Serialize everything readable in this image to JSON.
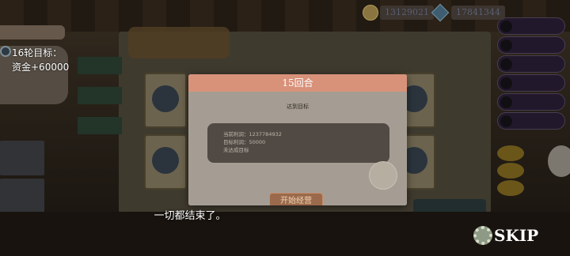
{
  "currency": {
    "gold": "13129021",
    "gems": "17841344"
  },
  "goal": {
    "label": "16轮目标：",
    "value": "资金+60000"
  },
  "modal": {
    "header": "15回合",
    "subtitle": "达到目标",
    "summary": [
      "当前利润：1237784932",
      "目标利润：50000",
      "未达成目标"
    ],
    "start_label": "开始经营"
  },
  "dialogue": "一切都结束了。",
  "skip_label": "SKIP"
}
